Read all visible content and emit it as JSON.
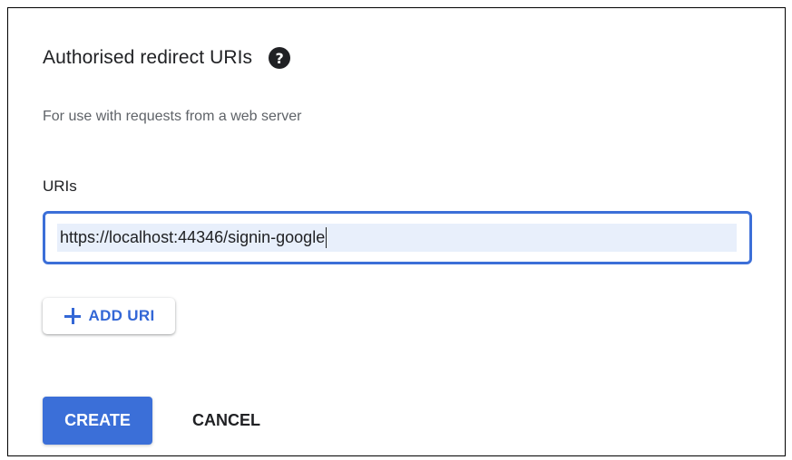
{
  "section": {
    "title": "Authorised redirect URIs",
    "help_icon": "help-circle-icon",
    "subtitle": "For use with requests from a web server"
  },
  "uris": {
    "label": "URIs",
    "value": "https://localhost:44346/signin-google"
  },
  "add_uri": {
    "icon": "plus-icon",
    "label": "ADD URI"
  },
  "actions": {
    "create_label": "CREATE",
    "cancel_label": "CANCEL"
  },
  "colors": {
    "accent": "#3367d6",
    "primary_button": "#3b6fd8",
    "input_focus_border": "#3c6fd8",
    "selection_highlight": "#e8effb",
    "secondary_text": "#5f6368"
  }
}
